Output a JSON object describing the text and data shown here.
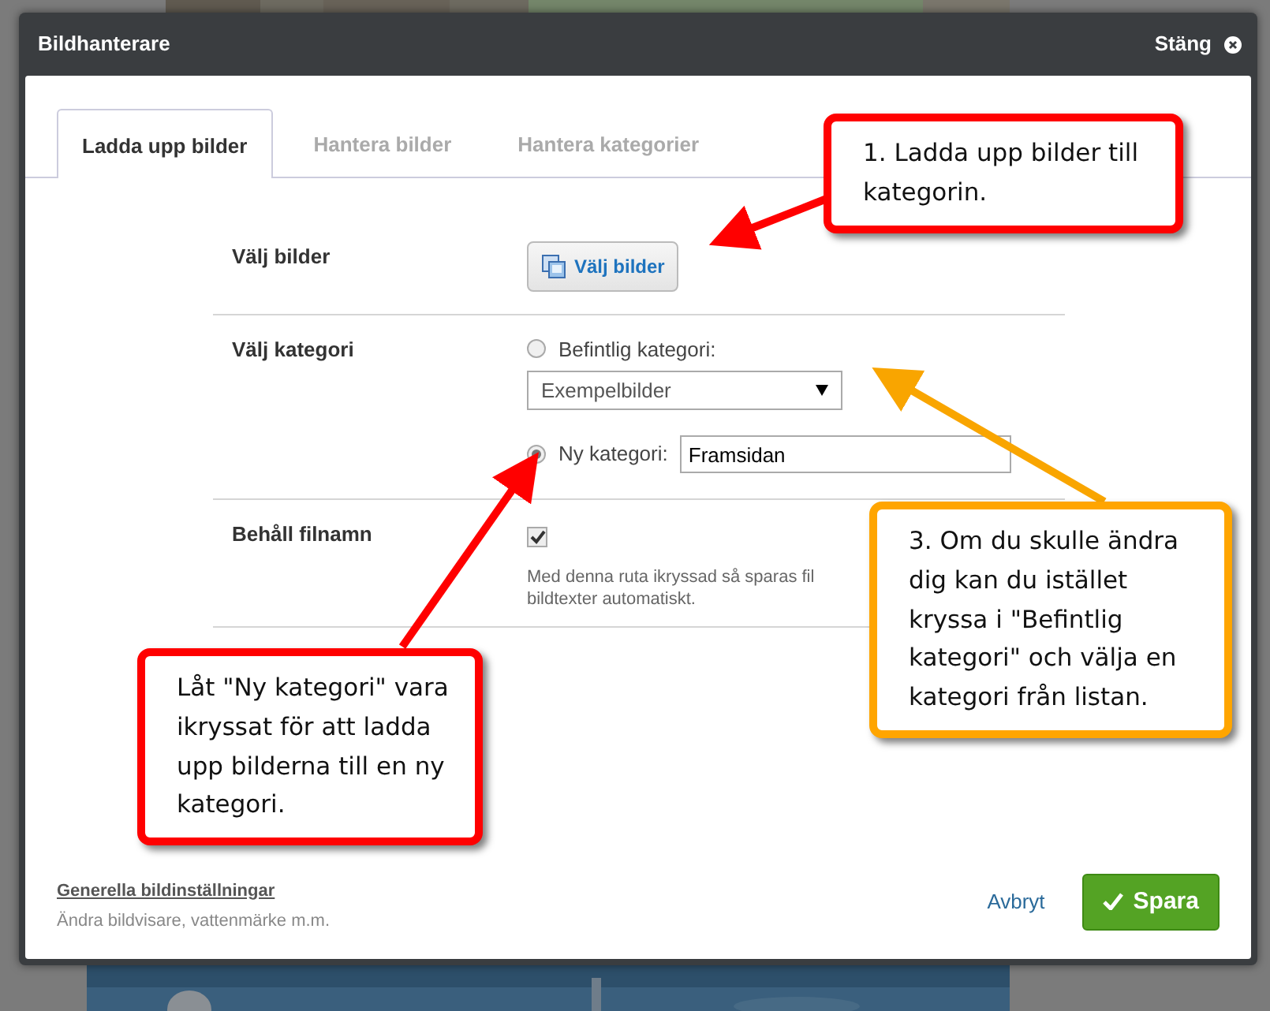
{
  "dialog": {
    "title": "Bildhanterare",
    "close_label": "Stäng"
  },
  "tabs": [
    {
      "label": "Ladda upp bilder",
      "selected": true
    },
    {
      "label": "Hantera bilder",
      "selected": false
    },
    {
      "label": "Hantera kategorier",
      "selected": false
    }
  ],
  "choose_images": {
    "label": "Välj bilder",
    "button": "Välj bilder"
  },
  "category": {
    "label": "Välj kategori",
    "options": [
      {
        "label": "Befintlig kategori:",
        "selected": false,
        "kind": "dropdown",
        "value": "Exempelbilder"
      },
      {
        "label": "Ny kategori:",
        "selected": true,
        "kind": "text",
        "value": "Framsidan"
      }
    ]
  },
  "keep_filenames": {
    "label": "Behåll filnamn",
    "checked": true,
    "help": [
      "Med denna ruta ikryssad så sparas fil",
      "bildtexter automatiskt."
    ]
  },
  "footer": {
    "settings_link": "Generella bildinställningar",
    "settings_hint": "Ändra bildvisare, vattenmärke m.m.",
    "cancel": "Avbryt",
    "save": "Spara"
  },
  "callouts": [
    {
      "text": "1. Ladda upp bilder till kategorin.",
      "color": "#ff0000"
    },
    {
      "text": "Låt \"Ny kategori\" vara ikryssat för att ladda upp bilderna till en ny kategori.",
      "color": "#ff0000"
    },
    {
      "text": "3. Om du skulle ändra dig kan du istället kryssa i \"Befintlig kategori\" och välja en kategori från listan.",
      "color": "#ffa500"
    }
  ]
}
